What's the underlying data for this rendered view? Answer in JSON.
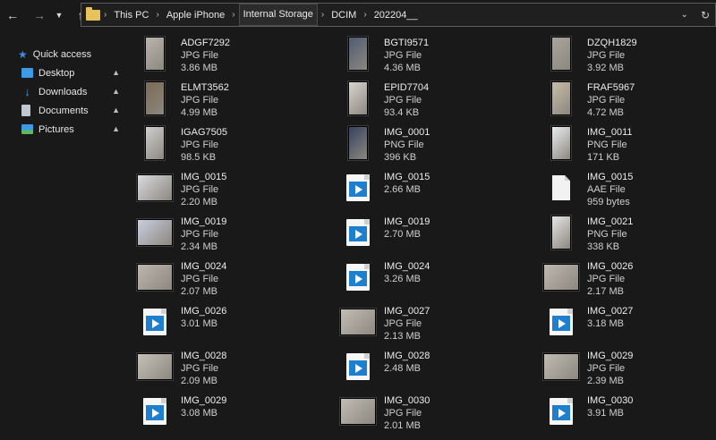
{
  "address": {
    "crumbs": [
      "This PC",
      "Apple iPhone",
      "Internal Storage",
      "DCIM",
      "202204__"
    ]
  },
  "sidebar": {
    "quick_access": "Quick access",
    "items": [
      {
        "label": "Desktop",
        "icon": "desktop-icon",
        "color": "#3c9be6"
      },
      {
        "label": "Downloads",
        "icon": "download-icon",
        "color": "#3c9be6"
      },
      {
        "label": "Documents",
        "icon": "documents-icon",
        "color": "#bfc7d0"
      },
      {
        "label": "Pictures",
        "icon": "pictures-icon",
        "color": "#3c9be6"
      }
    ]
  },
  "files": [
    {
      "name": "ADGF7292",
      "type": "JPG File",
      "size": "3.86 MB",
      "kind": "photo",
      "pw": 22,
      "ph": 38,
      "tone": "#b9b4ad"
    },
    {
      "name": "BGTI9571",
      "type": "JPG File",
      "size": "4.36 MB",
      "kind": "photo",
      "pw": 22,
      "ph": 38,
      "tone": "#4e5c72"
    },
    {
      "name": "DZQH1829",
      "type": "JPG File",
      "size": "3.92 MB",
      "kind": "photo",
      "pw": 22,
      "ph": 38,
      "tone": "#a9a49d"
    },
    {
      "name": "ELMT3562",
      "type": "JPG File",
      "size": "4.99 MB",
      "kind": "photo",
      "pw": 22,
      "ph": 38,
      "tone": "#7c6a55"
    },
    {
      "name": "EPID7704",
      "type": "JPG File",
      "size": "93.4 KB",
      "kind": "photo",
      "pw": 22,
      "ph": 38,
      "tone": "#d8d6cf"
    },
    {
      "name": "FRAF5967",
      "type": "JPG File",
      "size": "4.72 MB",
      "kind": "photo",
      "pw": 22,
      "ph": 38,
      "tone": "#c8bca7"
    },
    {
      "name": "IGAG7505",
      "type": "JPG File",
      "size": "98.5 KB",
      "kind": "photo",
      "pw": 22,
      "ph": 38,
      "tone": "#cfcfcf"
    },
    {
      "name": "IMG_0001",
      "type": "PNG File",
      "size": "396 KB",
      "kind": "photo",
      "pw": 22,
      "ph": 38,
      "tone": "#36425e"
    },
    {
      "name": "IMG_0011",
      "type": "PNG File",
      "size": "171 KB",
      "kind": "photo",
      "pw": 22,
      "ph": 38,
      "tone": "#e9eef0"
    },
    {
      "name": "IMG_0015",
      "type": "JPG File",
      "size": "2.20 MB",
      "kind": "photo",
      "pw": 40,
      "ph": 30,
      "tone": "#d9dbe0"
    },
    {
      "name": "IMG_0015",
      "type": "",
      "size": "2.66 MB",
      "kind": "video"
    },
    {
      "name": "IMG_0015",
      "type": "AAE File",
      "size": "959 bytes",
      "kind": "doc"
    },
    {
      "name": "IMG_0019",
      "type": "JPG File",
      "size": "2.34 MB",
      "kind": "photo",
      "pw": 40,
      "ph": 30,
      "tone": "#c9cfe0"
    },
    {
      "name": "IMG_0019",
      "type": "",
      "size": "2.70 MB",
      "kind": "video"
    },
    {
      "name": "IMG_0021",
      "type": "PNG File",
      "size": "338 KB",
      "kind": "photo",
      "pw": 22,
      "ph": 38,
      "tone": "#e6e6e6"
    },
    {
      "name": "IMG_0024",
      "type": "JPG File",
      "size": "2.07 MB",
      "kind": "photo",
      "pw": 40,
      "ph": 30,
      "tone": "#bdb7ae"
    },
    {
      "name": "IMG_0024",
      "type": "",
      "size": "3.26 MB",
      "kind": "video"
    },
    {
      "name": "IMG_0026",
      "type": "JPG File",
      "size": "2.17 MB",
      "kind": "photo",
      "pw": 40,
      "ph": 30,
      "tone": "#bdb8b0"
    },
    {
      "name": "IMG_0026",
      "type": "",
      "size": "3.01 MB",
      "kind": "video"
    },
    {
      "name": "IMG_0027",
      "type": "JPG File",
      "size": "2.13 MB",
      "kind": "photo",
      "pw": 40,
      "ph": 30,
      "tone": "#c3beb5"
    },
    {
      "name": "IMG_0027",
      "type": "",
      "size": "3.18 MB",
      "kind": "video"
    },
    {
      "name": "IMG_0028",
      "type": "JPG File",
      "size": "2.09 MB",
      "kind": "photo",
      "pw": 40,
      "ph": 30,
      "tone": "#c5c0b8"
    },
    {
      "name": "IMG_0028",
      "type": "",
      "size": "2.48 MB",
      "kind": "video"
    },
    {
      "name": "IMG_0029",
      "type": "JPG File",
      "size": "2.39 MB",
      "kind": "photo",
      "pw": 40,
      "ph": 30,
      "tone": "#bfbab2"
    },
    {
      "name": "IMG_0029",
      "type": "",
      "size": "3.08 MB",
      "kind": "video"
    },
    {
      "name": "IMG_0030",
      "type": "JPG File",
      "size": "2.01 MB",
      "kind": "photo",
      "pw": 40,
      "ph": 30,
      "tone": "#c1bcb4"
    },
    {
      "name": "IMG_0030",
      "type": "",
      "size": "3.91 MB",
      "kind": "video"
    }
  ]
}
